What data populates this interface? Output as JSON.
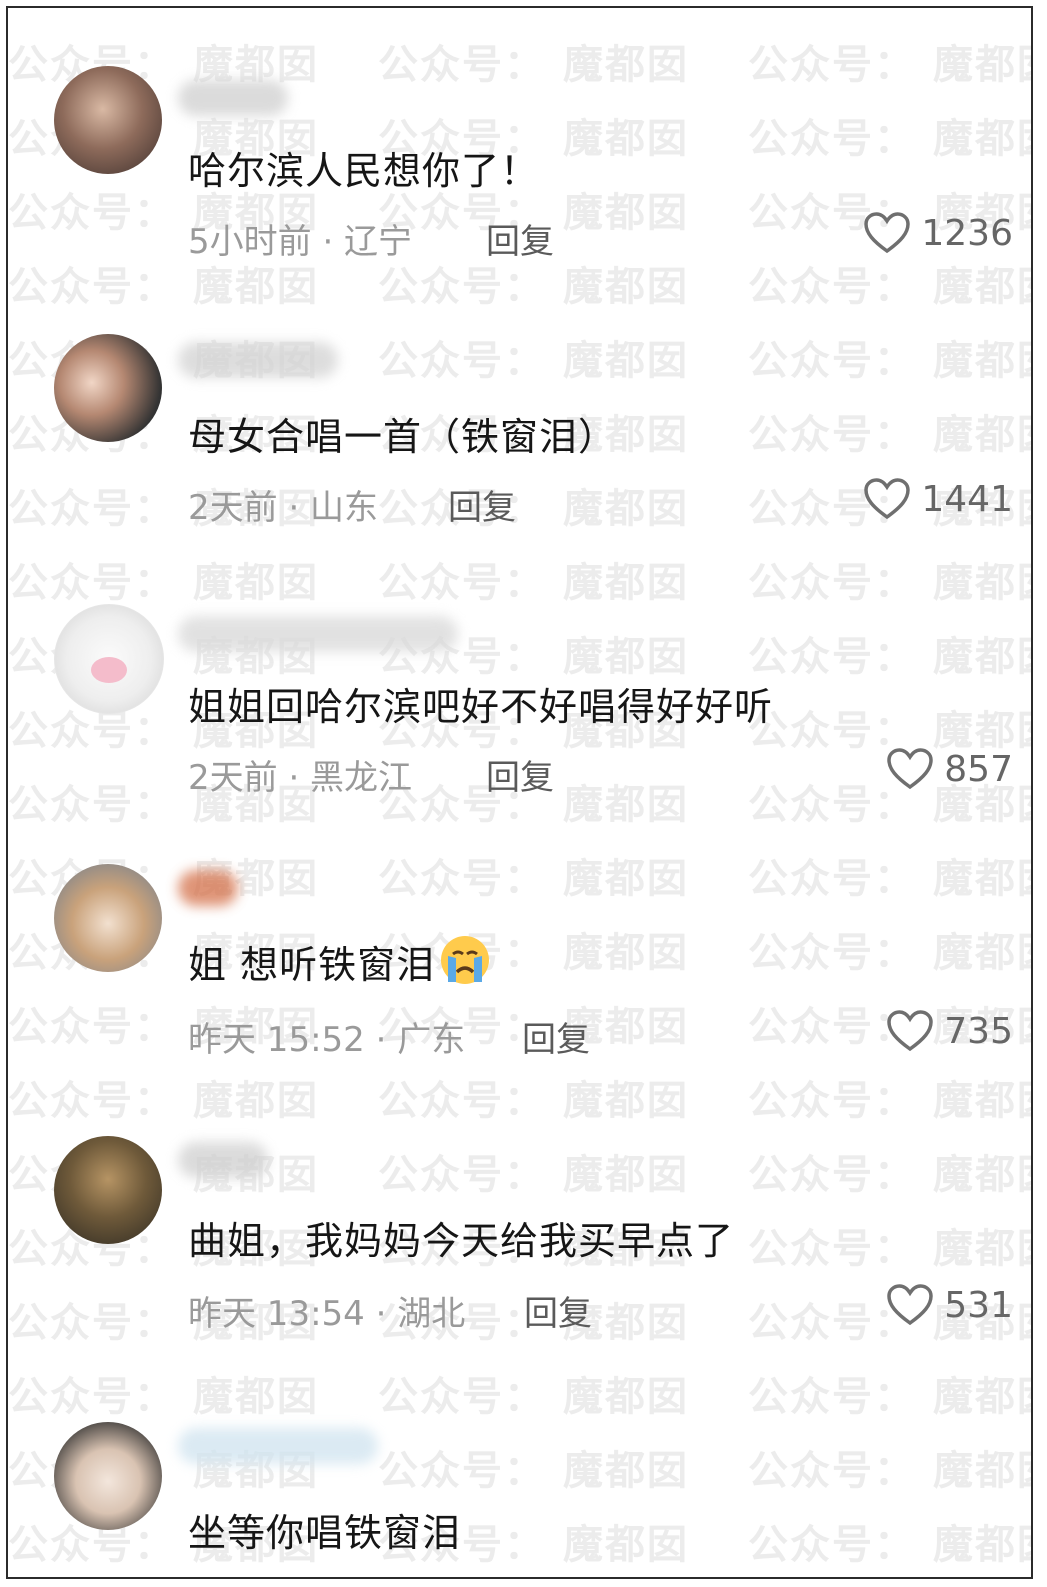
{
  "watermark": {
    "a": "公众号：",
    "b": "魔都囡"
  },
  "comments": [
    {
      "text": "哈尔滨人民想你了！",
      "meta": "5小时前 · 辽宁",
      "reply": "回复",
      "likes": "1236"
    },
    {
      "text": "母女合唱一首（铁窗泪）",
      "meta": "2天前 · 山东",
      "reply": "回复",
      "likes": "1441"
    },
    {
      "text": "姐姐回哈尔滨吧好不好唱得好好听",
      "meta": "2天前 · 黑龙江",
      "reply": "回复",
      "likes": "857"
    },
    {
      "text": "姐 想听铁窗泪",
      "emoji": "loudly-crying-face-icon",
      "meta": "昨天 15:52 · 广东",
      "reply": "回复",
      "likes": "735"
    },
    {
      "text": "曲姐，我妈妈今天给我买早点了",
      "meta": "昨天 13:54 · 湖北",
      "reply": "回复",
      "likes": "531"
    },
    {
      "text": "坐等你唱铁窗泪"
    }
  ],
  "colors": {
    "text": "#161616",
    "meta": "#9a9a9a",
    "reply": "#5a5a5a",
    "heart": "#6f6f6f",
    "watermark": "#ececec"
  }
}
